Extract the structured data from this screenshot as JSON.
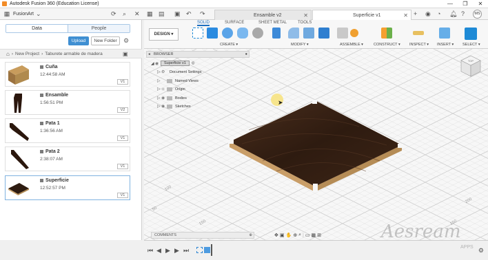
{
  "window": {
    "title": "Autodesk Fusion 360 (Education License)",
    "controls": [
      "—",
      "❐",
      "✕"
    ]
  },
  "topbar": {
    "project": "FusionArt",
    "tabs": [
      {
        "label": "Ensamble v2",
        "active": false
      },
      {
        "label": "Superficie v1",
        "active": true
      }
    ],
    "user_initials": "MS"
  },
  "databar": {
    "segments": [
      "Data",
      "People"
    ],
    "upload_label": "Upload",
    "new_folder_label": "New Folder",
    "breadcrumb": [
      "New Project",
      "Taburete armable de madera"
    ],
    "files": [
      {
        "name": "Cuña",
        "time": "12:44:58 AM",
        "version": "V1"
      },
      {
        "name": "Ensamble",
        "time": "1:56:51 PM",
        "version": "V2"
      },
      {
        "name": "Pata 1",
        "time": "1:36:56 AM",
        "version": "V1"
      },
      {
        "name": "Pata 2",
        "time": "2:38:07 AM",
        "version": "V1"
      },
      {
        "name": "Superficie",
        "time": "12:52:57 PM",
        "version": "V1"
      }
    ]
  },
  "ribbon": {
    "tabs": [
      "SOLID",
      "SURFACE",
      "SHEET METAL",
      "TOOLS"
    ],
    "design_label": "DESIGN ▾",
    "groups": [
      "CREATE ▾",
      "MODIFY ▾",
      "ASSEMBLE ▾",
      "CONSTRUCT ▾",
      "INSPECT ▾",
      "INSERT ▾",
      "SELECT ▾"
    ]
  },
  "browser": {
    "title": "BROWSER",
    "root": "Superficie v1",
    "nodes": [
      "Document Settings",
      "Named Views",
      "Origin",
      "Bodies",
      "Sketches"
    ]
  },
  "comments_label": "COMMENTS",
  "viewcube_label": "TOP",
  "grid_labels": [
    "200",
    "150",
    "100",
    "50",
    "150"
  ],
  "watermark": {
    "script": "Aesream",
    "small": "APPS"
  },
  "colors": {
    "accent": "#1d6fbf",
    "upload": "#3f8fd2",
    "wood": "#3b2417"
  }
}
